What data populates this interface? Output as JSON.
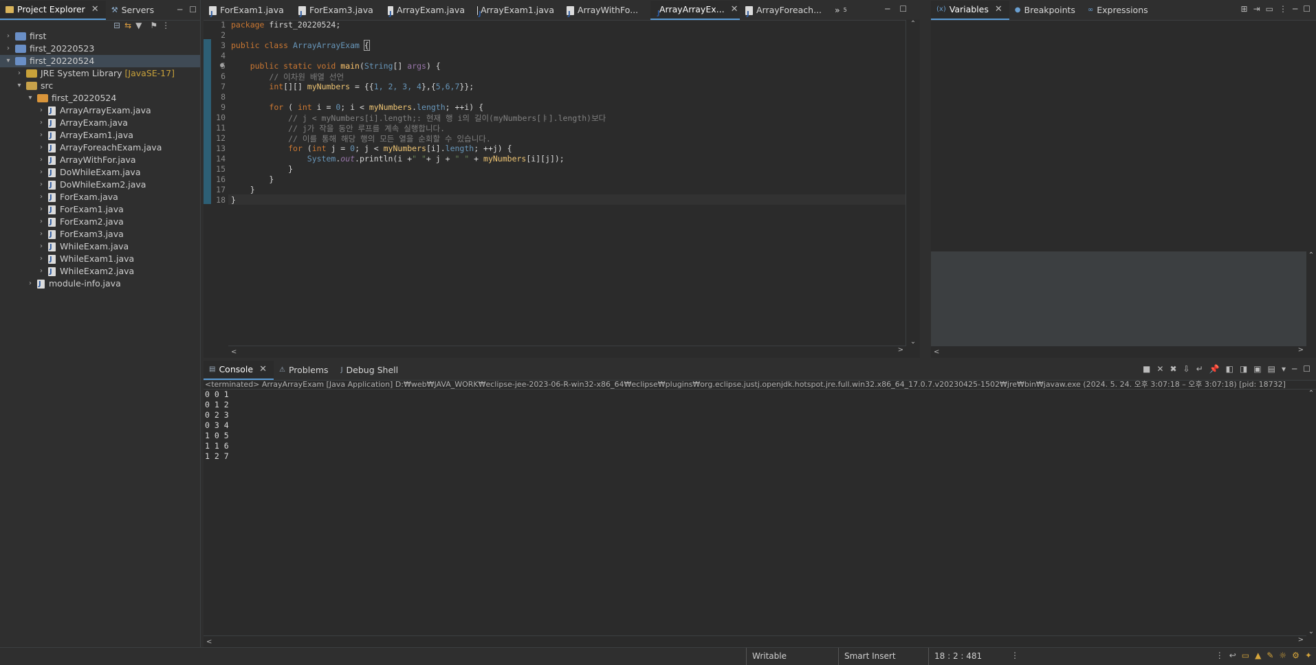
{
  "explorer": {
    "tabs": [
      {
        "label": "Project Explorer"
      },
      {
        "label": "Servers"
      }
    ],
    "tree": [
      {
        "label": "first",
        "level": 0,
        "arrow": ">",
        "kind": "project"
      },
      {
        "label": "first_20220523",
        "level": 0,
        "arrow": ">",
        "kind": "project"
      },
      {
        "label": "first_20220524",
        "level": 0,
        "arrow": "v",
        "kind": "project",
        "selected": true
      },
      {
        "label": "JRE System Library",
        "suffix": "[JavaSE-17]",
        "level": 1,
        "arrow": ">",
        "kind": "library"
      },
      {
        "label": "src",
        "level": 1,
        "arrow": "v",
        "kind": "folder"
      },
      {
        "label": "first_20220524",
        "level": 2,
        "arrow": "v",
        "kind": "package"
      },
      {
        "label": "ArrayArrayExam.java",
        "level": 3,
        "arrow": ">",
        "kind": "java"
      },
      {
        "label": "ArrayExam.java",
        "level": 3,
        "arrow": ">",
        "kind": "java"
      },
      {
        "label": "ArrayExam1.java",
        "level": 3,
        "arrow": ">",
        "kind": "java"
      },
      {
        "label": "ArrayForeachExam.java",
        "level": 3,
        "arrow": ">",
        "kind": "java"
      },
      {
        "label": "ArrayWithFor.java",
        "level": 3,
        "arrow": ">",
        "kind": "java"
      },
      {
        "label": "DoWhileExam.java",
        "level": 3,
        "arrow": ">",
        "kind": "java"
      },
      {
        "label": "DoWhileExam2.java",
        "level": 3,
        "arrow": ">",
        "kind": "java"
      },
      {
        "label": "ForExam.java",
        "level": 3,
        "arrow": ">",
        "kind": "java"
      },
      {
        "label": "ForExam1.java",
        "level": 3,
        "arrow": ">",
        "kind": "java"
      },
      {
        "label": "ForExam2.java",
        "level": 3,
        "arrow": ">",
        "kind": "java"
      },
      {
        "label": "ForExam3.java",
        "level": 3,
        "arrow": ">",
        "kind": "java"
      },
      {
        "label": "WhileExam.java",
        "level": 3,
        "arrow": ">",
        "kind": "java"
      },
      {
        "label": "WhileExam1.java",
        "level": 3,
        "arrow": ">",
        "kind": "java"
      },
      {
        "label": "WhileExam2.java",
        "level": 3,
        "arrow": ">",
        "kind": "java"
      },
      {
        "label": "module-info.java",
        "level": 2,
        "arrow": ">",
        "kind": "java"
      }
    ]
  },
  "editor": {
    "tabs": [
      {
        "label": "ForExam1.java"
      },
      {
        "label": "ForExam3.java"
      },
      {
        "label": "ArrayExam.java"
      },
      {
        "label": "ArrayExam1.java"
      },
      {
        "label": "ArrayWithFo..."
      },
      {
        "label": "ArrayArrayEx...",
        "active": true
      },
      {
        "label": "ArrayForeach..."
      }
    ],
    "overflow_label": "»",
    "overflow_count": "5",
    "line_numbers": [
      "1",
      "2",
      "3",
      "4",
      "5",
      "6",
      "7",
      "8",
      "9",
      "10",
      "11",
      "12",
      "13",
      "14",
      "15",
      "16",
      "17",
      "18"
    ]
  },
  "code": {
    "l1_kw": "package",
    "l1_rest": " first_20220524;",
    "l3_kw": "public class ",
    "l3_cls": "ArrayArrayExam",
    "l3_brace": "{",
    "l5_kw": "public static void ",
    "l5_fn": "main",
    "l5_p1": "(",
    "l5_ty": "String",
    "l5_p2": "[] ",
    "l5_arg": "args",
    "l5_p3": ") {",
    "l6": "// 이차원 배열 선언",
    "l7_kw": "int",
    "l7_a": "[][] ",
    "l7_var": "myNumbers",
    "l7_b": " = {{",
    "l7_n": "1, 2, 3, 4",
    "l7_c": "},{",
    "l7_n2": "5,6,7",
    "l7_d": "}};",
    "l9_kw": "for",
    "l9_a": " ( ",
    "l9_kw2": "int",
    "l9_b": " i = ",
    "l9_n": "0",
    "l9_c": "; i < ",
    "l9_var": "myNumbers",
    "l9_d": ".",
    "l9_fd": "length",
    "l9_e": "; ++i) {",
    "l10": "// j < myNumbers[i].length;: 현재 행 i의 길이(myNumbers[ㅑ].length)보다",
    "l11": "// j가 작을 동안 루프를 계속 실행합니다.",
    "l12": "// 이를 통해 해당 행의 모든 열을 순회할 수 있습니다.",
    "l13_kw": "for",
    "l13_a": " (",
    "l13_kw2": "int",
    "l13_b": " j = ",
    "l13_n": "0",
    "l13_c": "; j < ",
    "l13_var": "myNumbers",
    "l13_d": "[i].",
    "l13_fd": "length",
    "l13_e": "; ++j) {",
    "l14_ty": "System",
    "l14_a": ".",
    "l14_fd": "out",
    "l14_b": ".println(i +",
    "l14_s1": "\" \"",
    "l14_c": "+ j + ",
    "l14_s2": "\" \"",
    "l14_d": " + ",
    "l14_var": "myNumbers",
    "l14_e": "[i][j]);",
    "l15": "}",
    "l16": "}",
    "l17": "}",
    "l18": "}"
  },
  "debug": {
    "tabs": [
      {
        "label": "Variables",
        "active": true
      },
      {
        "label": "Breakpoints"
      },
      {
        "label": "Expressions"
      }
    ]
  },
  "console": {
    "tabs": [
      {
        "label": "Console",
        "active": true
      },
      {
        "label": "Problems"
      },
      {
        "label": "Debug Shell"
      }
    ],
    "header": "<terminated> ArrayArrayExam [Java Application] D:₩web₩JAVA_WORK₩eclipse-jee-2023-06-R-win32-x86_64₩eclipse₩plugins₩org.eclipse.justj.openjdk.hotspot.jre.full.win32.x86_64_17.0.7.v20230425-1502₩jre₩bin₩javaw.exe  (2024. 5. 24. 오후 3:07:18 – 오후 3:07:18) [pid: 18732]",
    "lines": [
      "0 0 1",
      "0 1 2",
      "0 2 3",
      "0 3 4",
      "1 0 5",
      "1 1 6",
      "1 2 7"
    ]
  },
  "status": {
    "writable": "Writable",
    "insert": "Smart Insert",
    "position": "18 : 2 : 481"
  },
  "colors": {
    "accent": "#5a9bd5",
    "bg": "#2f2f2f",
    "editor_bg": "#2b2b2b",
    "keyword": "#cc7832",
    "comment": "#808080"
  }
}
